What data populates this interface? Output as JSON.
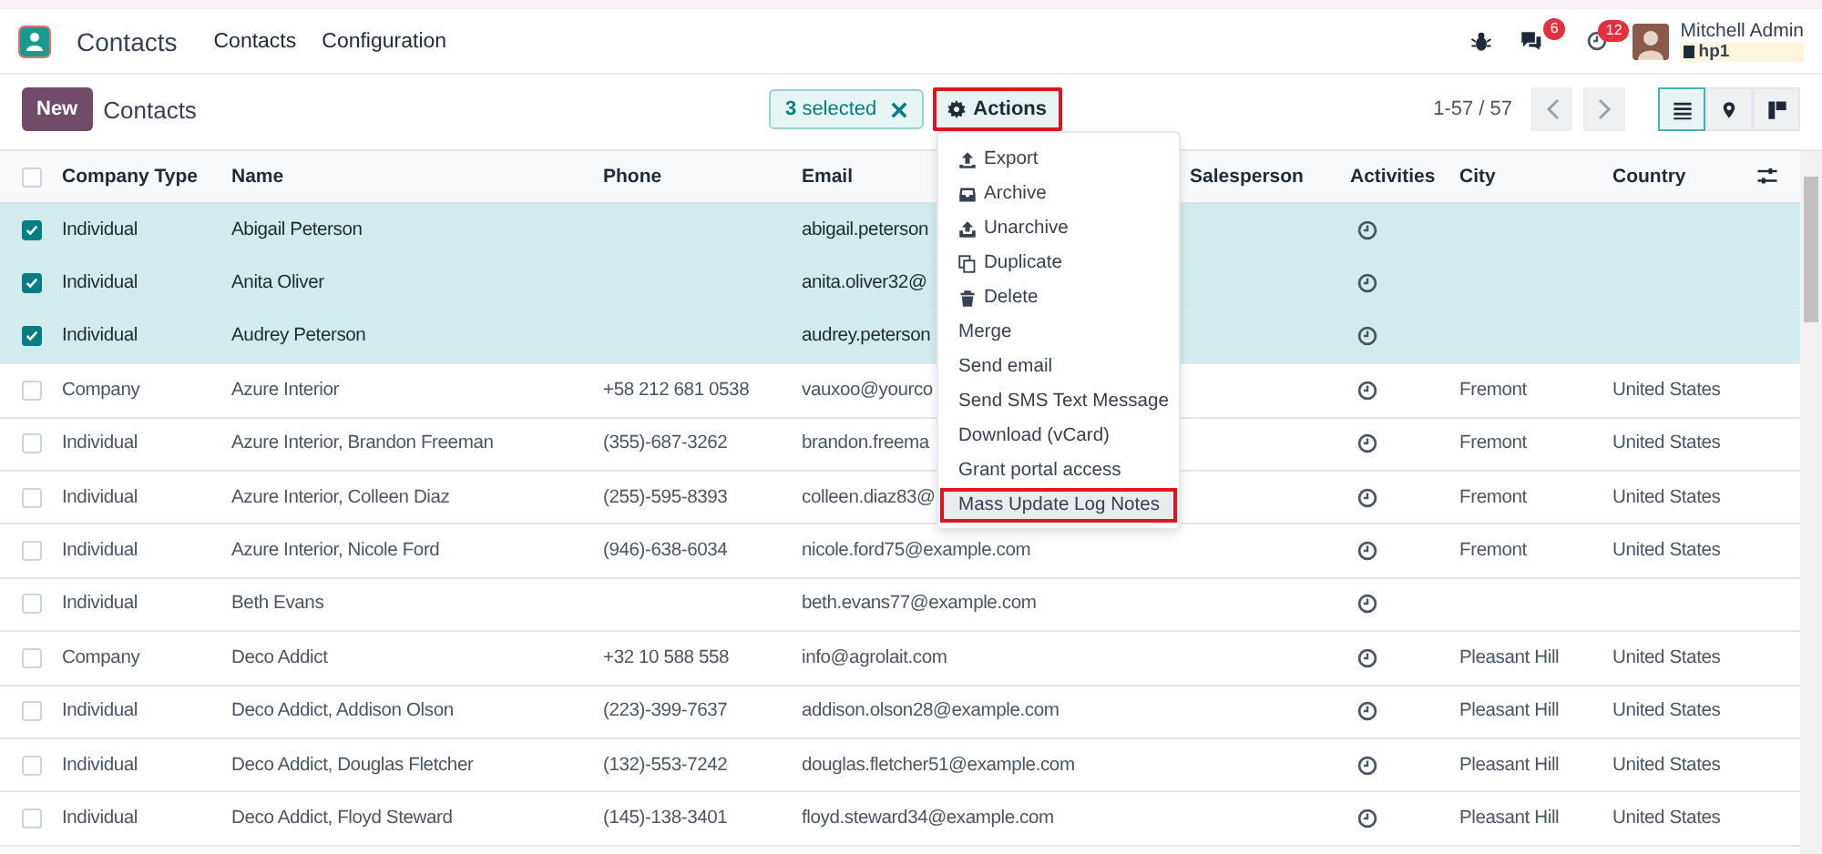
{
  "navbar": {
    "app_name": "Contacts",
    "menu": [
      "Contacts",
      "Configuration"
    ],
    "messages_badge": "6",
    "activities_badge": "12",
    "user_name": "Mitchell Admin",
    "company": "hp1"
  },
  "control_panel": {
    "new_button": "New",
    "breadcrumb": "Contacts",
    "selection": {
      "count": "3",
      "label": "selected"
    },
    "actions_button": {
      "label": "Actions",
      "highlighted": true
    },
    "pager": "1-57 / 57"
  },
  "view_switcher": [
    {
      "kind": "list",
      "selected": true
    },
    {
      "kind": "map",
      "selected": false
    },
    {
      "kind": "kanban",
      "selected": false
    }
  ],
  "table": {
    "all_selected": false,
    "columns": [
      "Company Type",
      "Name",
      "Phone",
      "Email",
      "Salesperson",
      "Activities",
      "City",
      "Country"
    ],
    "rows": [
      {
        "selected": true,
        "company_type": "Individual",
        "name": "Abigail Peterson",
        "phone": "",
        "email": "abigail.peterson",
        "city": "",
        "country": ""
      },
      {
        "selected": true,
        "company_type": "Individual",
        "name": "Anita Oliver",
        "phone": "",
        "email": "anita.oliver32@",
        "city": "",
        "country": ""
      },
      {
        "selected": true,
        "company_type": "Individual",
        "name": "Audrey Peterson",
        "phone": "",
        "email": "audrey.peterson",
        "city": "",
        "country": ""
      },
      {
        "selected": false,
        "company_type": "Company",
        "name": "Azure Interior",
        "phone": "+58 212 681 0538",
        "email": "vauxoo@yourco",
        "city": "Fremont",
        "country": "United States"
      },
      {
        "selected": false,
        "company_type": "Individual",
        "name": "Azure Interior, Brandon Freeman",
        "phone": "(355)-687-3262",
        "email": "brandon.freema",
        "city": "Fremont",
        "country": "United States"
      },
      {
        "selected": false,
        "company_type": "Individual",
        "name": "Azure Interior, Colleen Diaz",
        "phone": "(255)-595-8393",
        "email": "colleen.diaz83@",
        "city": "Fremont",
        "country": "United States"
      },
      {
        "selected": false,
        "company_type": "Individual",
        "name": "Azure Interior, Nicole Ford",
        "phone": "(946)-638-6034",
        "email": "nicole.ford75@example.com",
        "city": "Fremont",
        "country": "United States"
      },
      {
        "selected": false,
        "company_type": "Individual",
        "name": "Beth Evans",
        "phone": "",
        "email": "beth.evans77@example.com",
        "city": "",
        "country": ""
      },
      {
        "selected": false,
        "company_type": "Company",
        "name": "Deco Addict",
        "phone": "+32 10 588 558",
        "email": "info@agrolait.com",
        "city": "Pleasant Hill",
        "country": "United States"
      },
      {
        "selected": false,
        "company_type": "Individual",
        "name": "Deco Addict, Addison Olson",
        "phone": "(223)-399-7637",
        "email": "addison.olson28@example.com",
        "city": "Pleasant Hill",
        "country": "United States"
      },
      {
        "selected": false,
        "company_type": "Individual",
        "name": "Deco Addict, Douglas Fletcher",
        "phone": "(132)-553-7242",
        "email": "douglas.fletcher51@example.com",
        "city": "Pleasant Hill",
        "country": "United States"
      },
      {
        "selected": false,
        "company_type": "Individual",
        "name": "Deco Addict, Floyd Steward",
        "phone": "(145)-138-3401",
        "email": "floyd.steward34@example.com",
        "city": "Pleasant Hill",
        "country": "United States"
      }
    ]
  },
  "actions_menu": [
    {
      "kind": "export",
      "label": "Export",
      "highlighted": false
    },
    {
      "kind": "archive",
      "label": "Archive",
      "highlighted": false
    },
    {
      "kind": "unarchive",
      "label": "Unarchive",
      "highlighted": false
    },
    {
      "kind": "duplicate",
      "label": "Duplicate",
      "highlighted": false
    },
    {
      "kind": "delete",
      "label": "Delete",
      "highlighted": false
    },
    {
      "kind": "plain",
      "label": "Merge",
      "highlighted": false
    },
    {
      "kind": "plain",
      "label": "Send email",
      "highlighted": false
    },
    {
      "kind": "plain",
      "label": "Send SMS Text Message",
      "highlighted": false
    },
    {
      "kind": "plain",
      "label": "Download (vCard)",
      "highlighted": false
    },
    {
      "kind": "plain",
      "label": "Grant portal access",
      "highlighted": false
    },
    {
      "kind": "plain",
      "label": "Mass Update Log Notes",
      "highlighted": true
    }
  ]
}
